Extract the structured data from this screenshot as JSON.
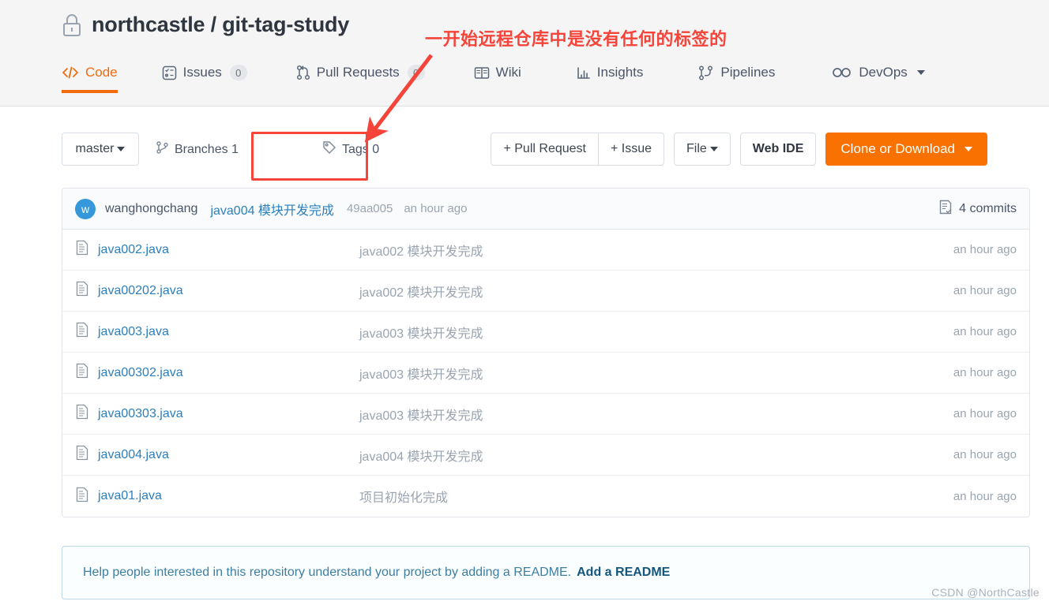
{
  "header": {
    "lock_icon": "lock-icon",
    "owner": "northcastle",
    "separator": "/",
    "repo": "git-tag-study",
    "full_title": "northcastle / git-tag-study"
  },
  "nav": {
    "tabs": [
      {
        "label": "Code",
        "icon": "code-brackets-icon",
        "badge": null,
        "active": true,
        "caret": false
      },
      {
        "label": "Issues",
        "icon": "issues-list-icon",
        "badge": "0",
        "active": false,
        "caret": false
      },
      {
        "label": "Pull Requests",
        "icon": "pull-request-icon",
        "badge": "0",
        "active": false,
        "caret": false
      },
      {
        "label": "Wiki",
        "icon": "book-icon",
        "badge": null,
        "active": false,
        "caret": false
      },
      {
        "label": "Insights",
        "icon": "bar-chart-icon",
        "badge": null,
        "active": false,
        "caret": false
      },
      {
        "label": "Pipelines",
        "icon": "pipeline-icon",
        "badge": null,
        "active": false,
        "caret": false
      },
      {
        "label": "DevOps",
        "icon": "infinity-icon",
        "badge": null,
        "active": false,
        "caret": true
      }
    ]
  },
  "toolbar": {
    "branch_select": "master",
    "branches_label": "Branches 1",
    "branches_icon": "branch-icon",
    "tags_label": "Tags 0",
    "tags_icon": "tag-icon",
    "pull_request_button": "+ Pull Request",
    "issue_button": "+ Issue",
    "file_button": "File",
    "web_ide_button": "Web IDE",
    "clone_button": "Clone or Download"
  },
  "commit_header": {
    "avatar_initial": "w",
    "author": "wanghongchang",
    "message": "java004 模块开发完成",
    "hash": "49aa005",
    "time": "an hour ago",
    "commits_count": "4 commits",
    "commits_icon": "commit-history-icon"
  },
  "files": {
    "icon": "file-text-icon",
    "rows": [
      {
        "name": "java002.java",
        "message": "java002 模块开发完成",
        "time": "an hour ago"
      },
      {
        "name": "java00202.java",
        "message": "java002 模块开发完成",
        "time": "an hour ago"
      },
      {
        "name": "java003.java",
        "message": "java003 模块开发完成",
        "time": "an hour ago"
      },
      {
        "name": "java00302.java",
        "message": "java003 模块开发完成",
        "time": "an hour ago"
      },
      {
        "name": "java00303.java",
        "message": "java003 模块开发完成",
        "time": "an hour ago"
      },
      {
        "name": "java004.java",
        "message": "java004 模块开发完成",
        "time": "an hour ago"
      },
      {
        "name": "java01.java",
        "message": "项目初始化完成",
        "time": "an hour ago"
      }
    ]
  },
  "readme": {
    "text": "Help people interested in this repository understand your project by adding a README.",
    "link": "Add a README"
  },
  "watermark": "CSDN @NorthCastle",
  "annotation": {
    "text": "一开始远程仓库中是没有任何的标签的",
    "color": "#f5453a",
    "highlight_target": "Tags 0"
  },
  "colors": {
    "accent_orange": "#f97100",
    "tab_active": "#f26b0f",
    "link_blue": "#2b7fbd",
    "muted": "#9aa4b0",
    "header_bg": "#f5f5f5",
    "annotation_red": "#f5453a"
  }
}
